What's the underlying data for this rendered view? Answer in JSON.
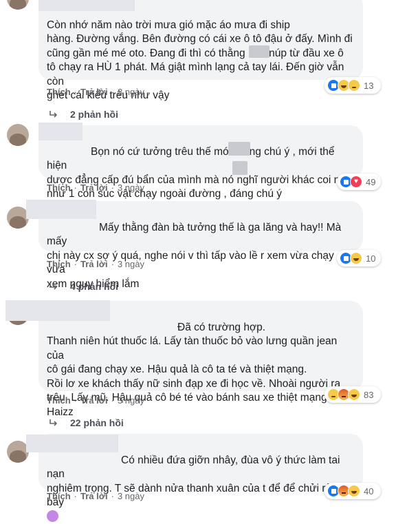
{
  "comments": [
    {
      "text": "Còn nhớ năm nào trời mưa gió mặc áo mưa đi ship\nhàng. Đường vắng. Bên đường có cái xe ô tô đậu ở đấy. Mình đi\ncũng gần mé mé oto. Đang đi thì có thằng       nào núp từ đầu xe ô\ntô chạy ra HÙ 1 phát. Má giật mình lạng cả tay lái. Đến giờ vẫn còn\nghét cái kiểu trêu như vậy",
      "like": "Thích",
      "reply": "Trả lời",
      "time": "3 ngày",
      "reaction_count": "13",
      "reactions": [
        "like",
        "haha",
        "sad"
      ],
      "replies": "2 phản hồi"
    },
    {
      "text": "Bọn nó cứ tưởng trêu thế mới có ng chú ý , mới thể hiện\ndược đẳng cấp đú bẩn của mình mà nó       nghĩ người khác coi nó\nnhư 1 con súc vật chạy ngoài đường ,      đáng chú ý",
      "like": "Thích",
      "reply": "Trả lời",
      "time": "3 ngày",
      "reaction_count": "49",
      "reactions": [
        "like",
        "love"
      ]
    },
    {
      "text": "Mấy thằng đàn bà tưởng thế là ga lăng và hay!! Mà mấy\nchị này cx sợ ý quá, nghe nói v thì tấp vào lề r xem vừa chạy vừa\nxem nguy hiểm lắm",
      "like": "Thích",
      "reply": "Trả lời",
      "time": "3 ngày",
      "reaction_count": "10",
      "reactions": [
        "like",
        "haha"
      ],
      "replies": "4 phản hồi"
    },
    {
      "text": "Đã có trường hợp.\nThanh niên hút thuốc lá. Lấy tàn thuốc bỏ vào lưng quần jean của\ncô gái đang chạy xe. Hậu quả là cô ta té và thiệt mạng.\nRồi lơ xe khách thấy nữ sinh đạp xe đi học về. Nhoài người ra\ntrêu. Lấy mũ. Hậu quả cô bé té vào bánh sau xe thiệt mạng.\nHaizz",
      "like": "Thích",
      "reply": "Trả lời",
      "time": "3 ngày",
      "reaction_count": "83",
      "reactions": [
        "sad",
        "angry",
        "haha"
      ],
      "replies": "22 phản hồi"
    },
    {
      "text": "Có nhiều đứa giỡn nhây, đùa vô ý thức làm tai nạn\nnghiêm trọng. T sẽ dành nửa thanh xuân của t để để chửi rủa tụi\nbây",
      "like": "Thích",
      "reply": "Trả lời",
      "time": "3 ngày",
      "reaction_count": "40",
      "reactions": [
        "like",
        "angry",
        "haha"
      ]
    }
  ]
}
